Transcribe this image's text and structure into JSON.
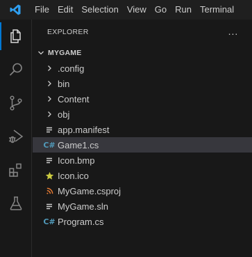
{
  "menu": [
    "File",
    "Edit",
    "Selection",
    "View",
    "Go",
    "Run",
    "Terminal"
  ],
  "explorer": {
    "title": "EXPLORER",
    "more_label": "...",
    "folder": "MYGAME"
  },
  "tree": [
    {
      "label": ".config",
      "kind": "folder",
      "icon": "chevron-right-icon"
    },
    {
      "label": "bin",
      "kind": "folder",
      "icon": "chevron-right-icon"
    },
    {
      "label": "Content",
      "kind": "folder",
      "icon": "chevron-right-icon"
    },
    {
      "label": "obj",
      "kind": "folder",
      "icon": "chevron-right-icon"
    },
    {
      "label": "app.manifest",
      "kind": "file",
      "icon": "lines-file-icon"
    },
    {
      "label": "Game1.cs",
      "kind": "file",
      "icon": "csharp-icon",
      "selected": true
    },
    {
      "label": "Icon.bmp",
      "kind": "file",
      "icon": "lines-file-icon"
    },
    {
      "label": "Icon.ico",
      "kind": "file",
      "icon": "star-icon"
    },
    {
      "label": "MyGame.csproj",
      "kind": "file",
      "icon": "rss-icon"
    },
    {
      "label": "MyGame.sln",
      "kind": "file",
      "icon": "lines-file-icon"
    },
    {
      "label": "Program.cs",
      "kind": "file",
      "icon": "csharp-icon"
    }
  ],
  "colors": {
    "accent": "#0078d4",
    "csharp": "#519aba",
    "star": "#cbcb41",
    "rss": "#e37933",
    "selected_row": "#37373d"
  }
}
